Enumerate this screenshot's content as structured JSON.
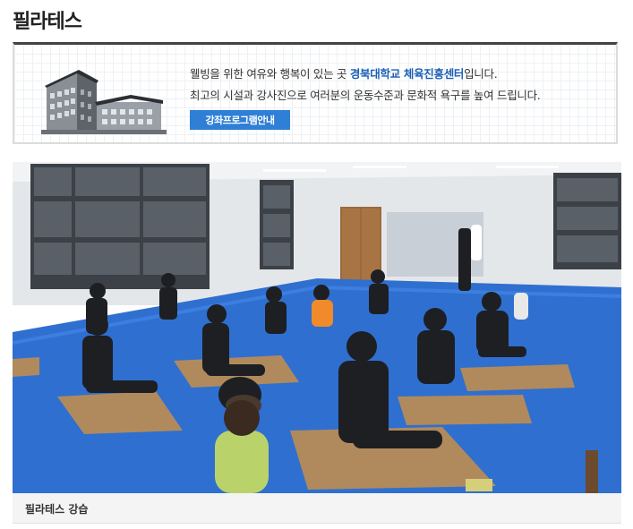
{
  "page": {
    "title": "필라테스"
  },
  "intro": {
    "line1_prefix": "웰빙을 위한 여유와 행복이 있는 곳 ",
    "line1_highlight": "경북대학교 체육진흥센터",
    "line1_suffix": "입니다.",
    "line2": "최고의 시설과 강사진으로 여러분의 운동수준과 문화적 욕구를 높여 드립니다.",
    "button_label": "강좌프로그램안내"
  },
  "photo": {
    "caption": "필라테스 강습"
  },
  "colors": {
    "accent": "#2f7fd6",
    "highlight": "#1a5fb4",
    "mat_floor": "#2f6fd0"
  }
}
